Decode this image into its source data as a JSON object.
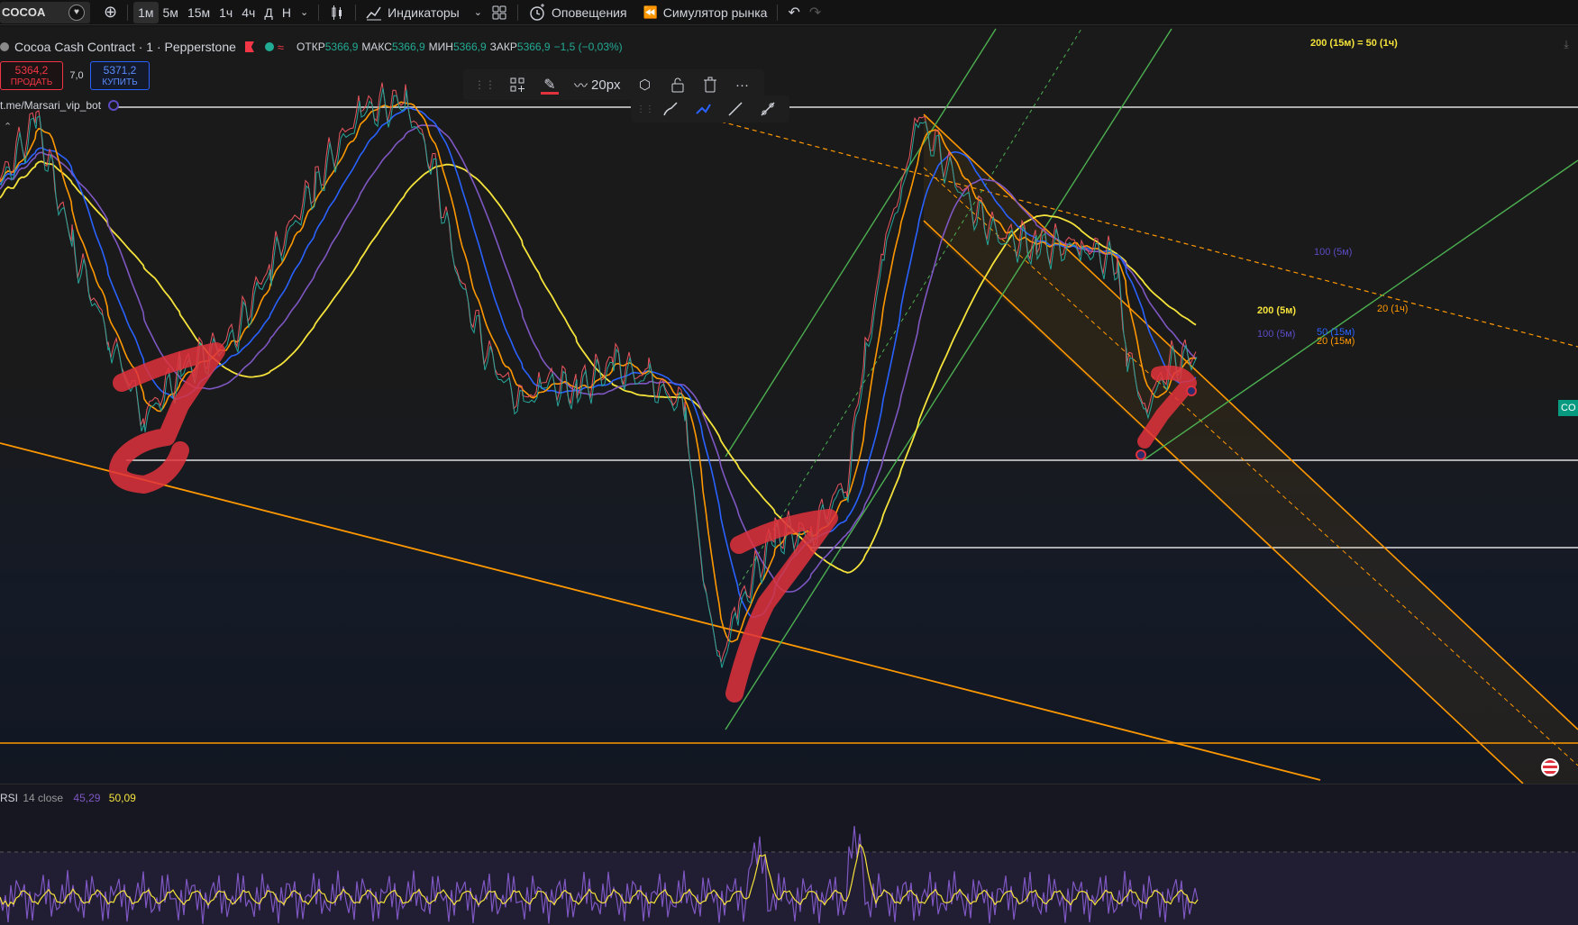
{
  "toolbar": {
    "symbol": "COCOA",
    "intervals": [
      "1м",
      "5м",
      "15м",
      "1ч",
      "4ч",
      "Д",
      "Н"
    ],
    "active_interval": "1м",
    "indicators_label": "Индикаторы",
    "alerts_label": "Оповещения",
    "replay_label": "Симулятор рынка"
  },
  "legend": {
    "title": "Cocoa Cash Contract · 1 · Pepperstone",
    "open_label": "ОТКР",
    "open_value": "5366,9",
    "high_label": "МАКС",
    "high_value": "5366,9",
    "low_label": "МИН",
    "low_value": "5366,9",
    "close_label": "ЗАКР",
    "close_value": "5366,9",
    "change": "−1,5 (−0,03%)"
  },
  "trade": {
    "sell_price": "5364,2",
    "sell_label": "ПРОДАТЬ",
    "spread": "7,0",
    "buy_price": "5371,2",
    "buy_label": "КУПИТЬ"
  },
  "link_label": "t.me/Marsari_vip_bot",
  "drawing_toolbar": {
    "width_label": "20px"
  },
  "right_labels": {
    "top_label": "200 (15м) = 50 (1ч)",
    "ma100_5m_top": "100 (5м)",
    "ma20_1h": "20 (1ч)",
    "ma200_5m": "200 (5м)",
    "ma100_5m": "100 (5м)",
    "ma50_15m": "50 (15м)",
    "ma20_15m": "20 (15м)",
    "price_tag": "CO"
  },
  "rsi": {
    "label": "RSI",
    "params": "14 close",
    "value1": "45,29",
    "value2": "50,09"
  },
  "colors": {
    "ma_yellow": "#f5e33b",
    "ma_purple": "#7e57c2",
    "ma_blue": "#2962ff",
    "ma_orange": "#ff9800",
    "trend_orange": "#ff9800",
    "trend_green": "#4caf50",
    "brush_red": "#e0323c"
  }
}
